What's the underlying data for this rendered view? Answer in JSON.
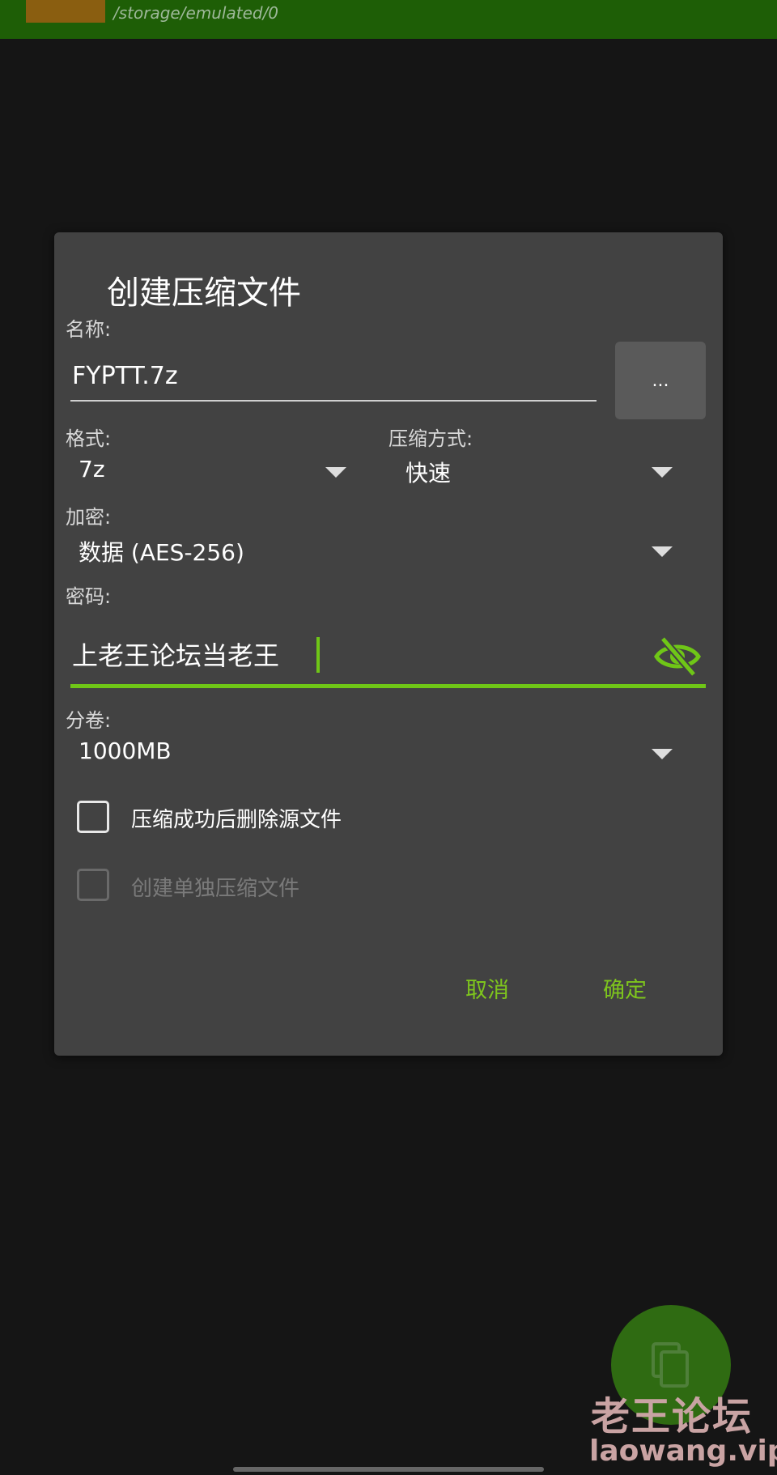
{
  "header": {
    "path": "/storage/emulated/0"
  },
  "dialog": {
    "title": "创建压缩文件",
    "name_label": "名称:",
    "name_value": "FYPTT.7z",
    "browse_label": "...",
    "format_label": "格式:",
    "format_value": "7z",
    "method_label": "压缩方式:",
    "method_value": "快速",
    "encryption_label": "加密:",
    "encryption_value": "数据 (AES-256)",
    "password_label": "密码:",
    "password_value": "上老王论坛当老王",
    "volume_label": "分卷:",
    "volume_value": "1000MB",
    "delete_source_label": "压缩成功后删除源文件",
    "separate_archives_label": "创建单独压缩文件",
    "cancel_label": "取消",
    "ok_label": "确定"
  },
  "watermark": {
    "title": "老王论坛",
    "url": "laowang.vip"
  },
  "icons": [
    "caret-down-icon",
    "eye-off-icon",
    "copy-icon"
  ],
  "colors": {
    "accent": "#7ec51d",
    "dialog_bg": "#424242",
    "screen_bg": "#151515",
    "topbar": "#1e5e06"
  }
}
